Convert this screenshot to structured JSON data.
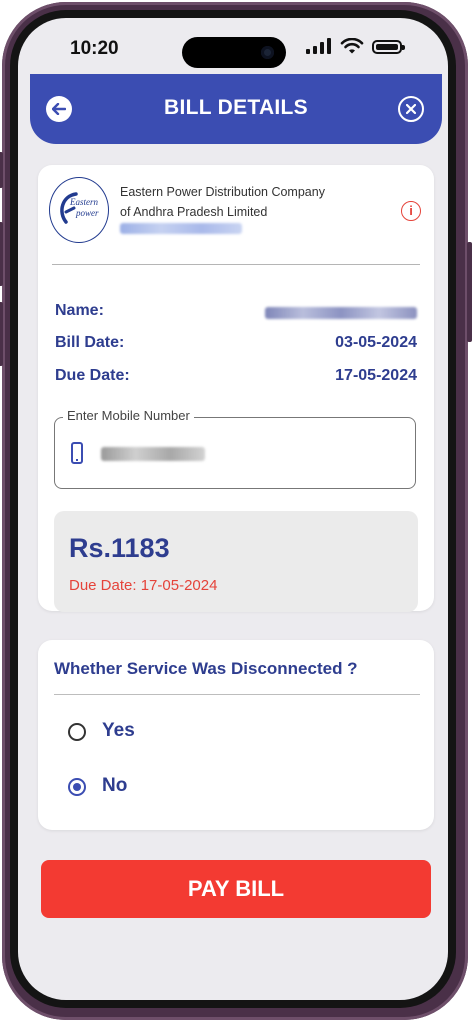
{
  "status_bar": {
    "time": "10:20",
    "icons": [
      "signal-icon",
      "wifi-icon",
      "battery-icon"
    ]
  },
  "header": {
    "title": "BILL DETAILS",
    "back_icon": "arrow-left-icon",
    "close_icon": "close-circle-icon",
    "background_color": "#3b4db2"
  },
  "bill_card": {
    "logo_text_line1": "Eastern",
    "logo_text_line2": "power",
    "company_line1": "Eastern Power Distribution Company",
    "company_line2": "of Andhra Pradesh Limited",
    "info_icon_glyph": "i",
    "fields": [
      {
        "label": "Name:",
        "value": ""
      },
      {
        "label": "Bill Date:",
        "value": "03-05-2024"
      },
      {
        "label": "Due Date:",
        "value": "17-05-2024"
      }
    ],
    "mobile_field": {
      "label": "Enter Mobile Number"
    },
    "amount": "Rs.1183",
    "amount_due_text": "Due Date: 17-05-2024"
  },
  "disconnection_card": {
    "question": "Whether Service Was Disconnected ?",
    "options": [
      {
        "label": "Yes",
        "selected": false
      },
      {
        "label": "No",
        "selected": true
      }
    ]
  },
  "pay_button": {
    "label": "PAY BILL",
    "color": "#f33a32"
  }
}
